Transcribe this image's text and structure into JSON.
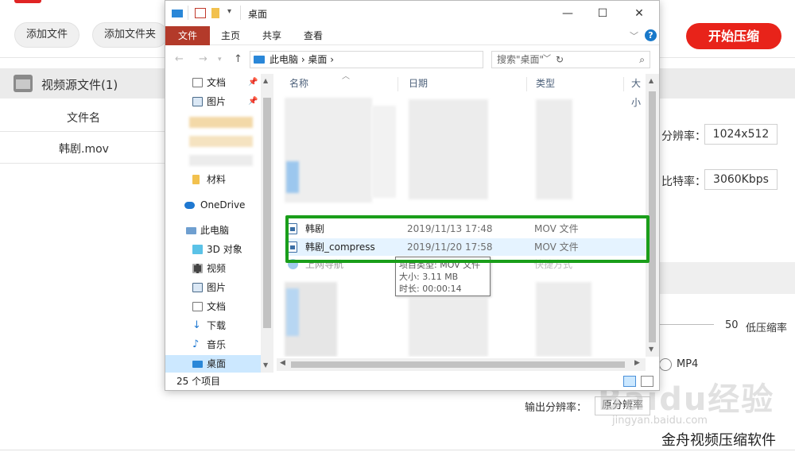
{
  "app": {
    "add_file_label": "添加文件",
    "add_folder_label": "添加文件夹",
    "start_label": "开始压缩",
    "source_title": "视频源文件(1)",
    "filename_header": "文件名",
    "file_row": "韩剧.mov",
    "resolution_label": "分辨率：",
    "resolution_value": "1024x512",
    "bitrate_label": "比特率：",
    "bitrate_value": "3060Kbps",
    "slider_value": "50",
    "slider_label": "低压缩率",
    "format_label": "MP4",
    "output_res_label": "输出分辨率：",
    "output_res_value": "原分辨率",
    "brand": "金舟视频压缩软件",
    "watermark": "Baidu经验",
    "watermark_sub": "jingyan.baidu.com",
    "accent_color": "#e8231a"
  },
  "explorer": {
    "title": "桌面",
    "tabs": {
      "file": "文件",
      "home": "主页",
      "share": "共享",
      "view": "查看"
    },
    "address": "此电脑 › 桌面 ›",
    "search_placeholder": "搜索\"桌面\"",
    "nav": {
      "documents": "文档",
      "pictures": "图片",
      "materials": "材料",
      "onedrive": "OneDrive",
      "this_pc": "此电脑",
      "objects3d": "3D 对象",
      "videos": "视频",
      "pictures2": "图片",
      "documents2": "文档",
      "downloads": "下载",
      "music": "音乐",
      "desktop": "桌面"
    },
    "columns": {
      "name": "名称",
      "date": "日期",
      "type": "类型",
      "size": "大小"
    },
    "files": [
      {
        "name": "韩剧",
        "date": "2019/11/13 17:48",
        "type": "MOV 文件"
      },
      {
        "name": "韩剧_compress",
        "date": "2019/11/20 17:58",
        "type": "MOV 文件"
      }
    ],
    "partial_row": {
      "name": "上网导航",
      "type": "快捷方式"
    },
    "tooltip": {
      "line1": "项目类型: MOV 文件",
      "line2": "大小: 3.11 MB",
      "line3": "时长: 00:00:14"
    },
    "status": "25 个项目",
    "highlight_color": "#1a9e1a"
  }
}
